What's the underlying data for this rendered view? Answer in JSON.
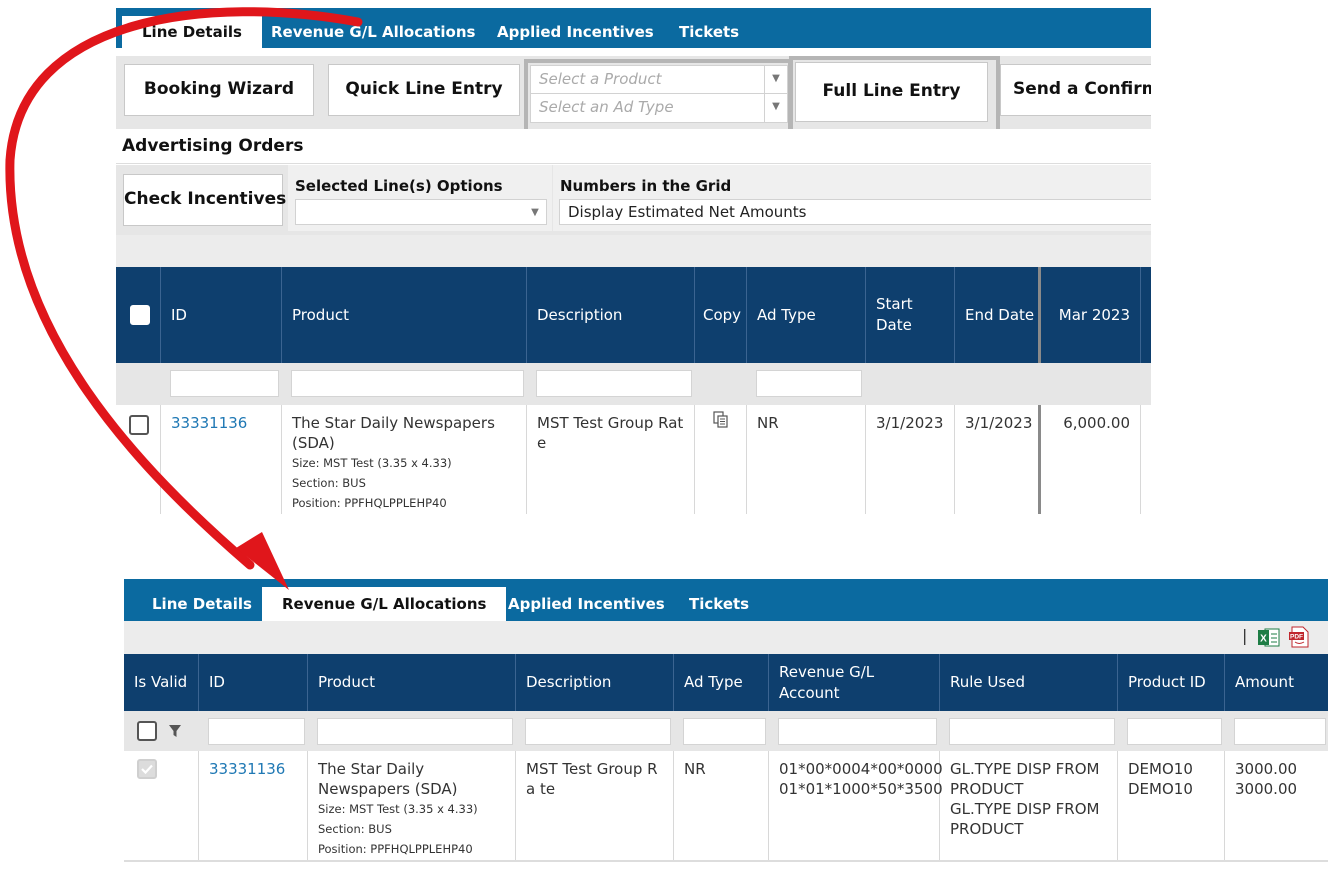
{
  "top": {
    "tabs": [
      "Line Details",
      "Revenue G/L Allocations",
      "Applied Incentives",
      "Tickets"
    ],
    "toolbar": {
      "booking_wizard": "Booking Wizard",
      "quick_line_entry": "Quick Line Entry",
      "product_placeholder": "Select a Product",
      "adtype_placeholder": "Select an Ad Type",
      "full_line_entry": "Full Line Entry",
      "send_confirmation": "Send a Confirmat"
    },
    "section_title": "Advertising Orders",
    "check_incentives": "Check Incentives",
    "selected_options_label": "Selected Line(s) Options",
    "numbers_label": "Numbers in the Grid",
    "numbers_value": "Display Estimated Net Amounts",
    "columns": [
      "ID",
      "Product",
      "Description",
      "Copy",
      "Ad Type",
      "Start Date",
      "End Date",
      "Mar 2023"
    ],
    "row": {
      "id": "33331136",
      "product": "The Star Daily Newspapers (SDA)",
      "size": "Size: MST Test (3.35 x 4.33)",
      "section": "Section: BUS",
      "position": "Position: PPFHQLPPLEHP40",
      "description": "MST Test Group Rat e",
      "ad_type": "NR",
      "start_date": "3/1/2023",
      "end_date": "3/1/2023",
      "mar_2023": "6,000.00"
    }
  },
  "bottom": {
    "tabs": [
      "Line Details",
      "Revenue G/L Allocations",
      "Applied Incentives",
      "Tickets"
    ],
    "toolbar_separator": "|",
    "columns": [
      "Is Valid",
      "ID",
      "Product",
      "Description",
      "Ad Type",
      "Revenue G/L Account",
      "Rule Used",
      "Product ID",
      "Amount"
    ],
    "row": {
      "id": "33331136",
      "product": "The Star Daily Newspapers (SDA)",
      "size": "Size: MST Test (3.35 x 4.33)",
      "section": "Section: BUS",
      "position": "Position: PPFHQLPPLEHP40",
      "description": "MST Test Group Ra te",
      "ad_type": "NR",
      "gl_accounts": [
        "01*00*0004*00*0000",
        "01*01*1000*50*3500"
      ],
      "rules": [
        "GL.TYPE DISP FROM PRODUCT",
        "GL.TYPE DISP FROM PRODUCT"
      ],
      "product_ids": [
        "DEMO10",
        "DEMO10"
      ],
      "amounts": [
        "3000.00",
        "3000.00"
      ]
    }
  },
  "colors": {
    "tab_bar": "#0b6aa0",
    "grid_header": "#0e3f6e",
    "arrow": "#e0161b",
    "link": "#1f78b4"
  },
  "icons": [
    "excel-export-icon",
    "pdf-export-icon",
    "filter-icon",
    "copy-icon",
    "dropdown-arrow-icon"
  ]
}
